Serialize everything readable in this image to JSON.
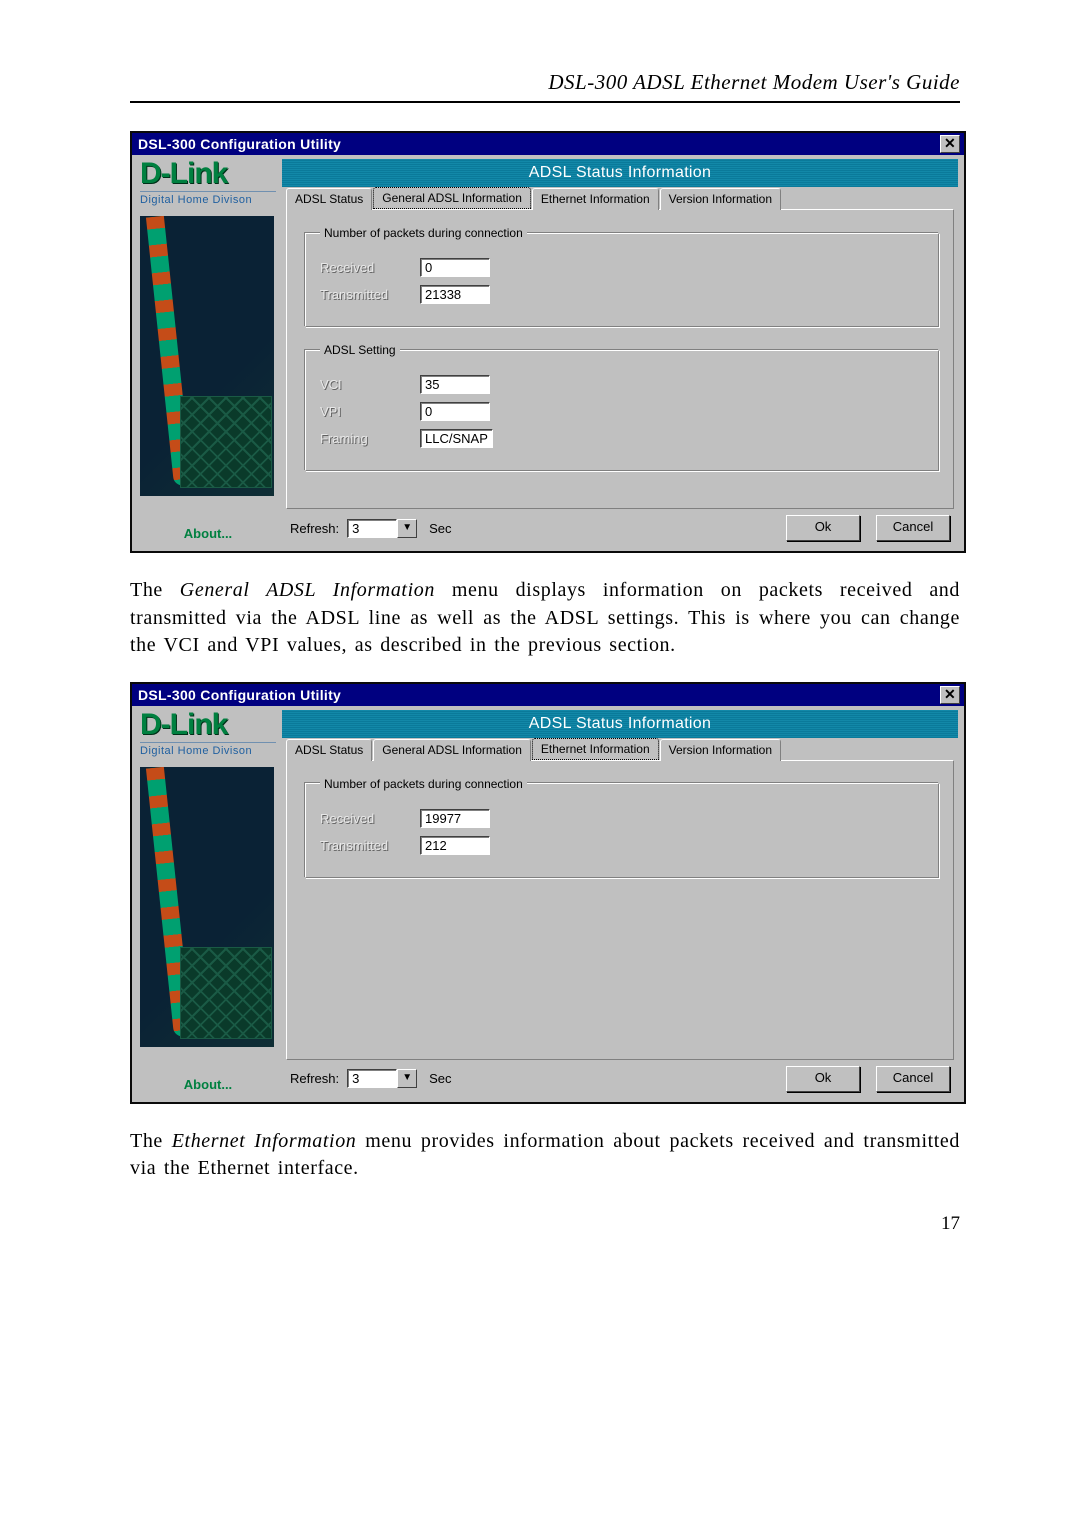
{
  "header": "DSL-300 ADSL Ethernet Modem User's Guide",
  "page_number": "17",
  "brand": {
    "name": "D-Link",
    "tagline": "Digital Home Divison"
  },
  "dialog1": {
    "title": "DSL-300 Configuration Utility",
    "close": "✕",
    "banner": "ADSL Status Information",
    "tabs": {
      "t0": "ADSL Status",
      "t1": "General ADSL Information",
      "t2": "Ethernet Information",
      "t3": "Version Information"
    },
    "group1": {
      "legend": "Number of packets during connection",
      "received_label": "Received",
      "received_value": "0",
      "transmitted_label": "Transmitted",
      "transmitted_value": "21338"
    },
    "group2": {
      "legend": "ADSL Setting",
      "vci_label": "VCI",
      "vci_value": "35",
      "vpi_label": "VPI",
      "vpi_value": "0",
      "framing_label": "Framing",
      "framing_value": "LLC/SNAP"
    },
    "about": "About...",
    "refresh_label": "Refresh:",
    "refresh_value": "3",
    "refresh_unit": "Sec",
    "ok": "Ok",
    "cancel": "Cancel"
  },
  "para1_pre": "The ",
  "para1_em": "General ADSL Information",
  "para1_post": " menu displays information on packets received and transmitted via the ADSL line as well as the ADSL settings. This is where you can change the VCI and VPI values, as described in the previous section.",
  "dialog2": {
    "title": "DSL-300 Configuration Utility",
    "close": "✕",
    "banner": "ADSL Status Information",
    "tabs": {
      "t0": "ADSL Status",
      "t1": "General ADSL Information",
      "t2": "Ethernet Information",
      "t3": "Version Information"
    },
    "group1": {
      "legend": "Number of packets during connection",
      "received_label": "Received",
      "received_value": "19977",
      "transmitted_label": "Transmitted",
      "transmitted_value": "212"
    },
    "about": "About...",
    "refresh_label": "Refresh:",
    "refresh_value": "3",
    "refresh_unit": "Sec",
    "ok": "Ok",
    "cancel": "Cancel"
  },
  "para2_pre": "The ",
  "para2_em": "Ethernet Information",
  "para2_post": " menu provides information about packets received and transmitted via the Ethernet interface."
}
